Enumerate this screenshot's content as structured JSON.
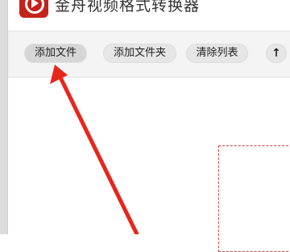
{
  "app": {
    "title": "金舟视频格式转换器",
    "logo_icon": "video-play-icon",
    "accent_color": "#c4221a"
  },
  "toolbar": {
    "add_file_label": "添加文件",
    "add_folder_label": "添加文件夹",
    "clear_list_label": "清除列表",
    "move_up_icon": "arrow-up-icon",
    "move_up_glyph": "↑"
  },
  "annotation": {
    "arrow_color": "#e8261d"
  }
}
